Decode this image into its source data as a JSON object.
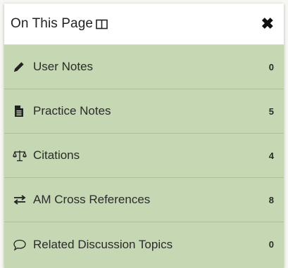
{
  "header": {
    "title": "On This Page",
    "book_icon": "book-open-icon",
    "close_icon": "close-icon",
    "close_glyph": "✖"
  },
  "items": [
    {
      "label": "User Notes",
      "count": "0",
      "icon": "pencil-icon"
    },
    {
      "label": "Practice Notes",
      "count": "5",
      "icon": "document-icon"
    },
    {
      "label": "Citations",
      "count": "4",
      "icon": "balance-scale-icon"
    },
    {
      "label": "AM Cross References",
      "count": "8",
      "icon": "exchange-arrows-icon"
    },
    {
      "label": "Related Discussion Topics",
      "count": "0",
      "icon": "comment-icon"
    }
  ],
  "colors": {
    "panel_background": "#c6d7b3",
    "header_background": "#ffffff",
    "text": "#2b2b2b"
  }
}
